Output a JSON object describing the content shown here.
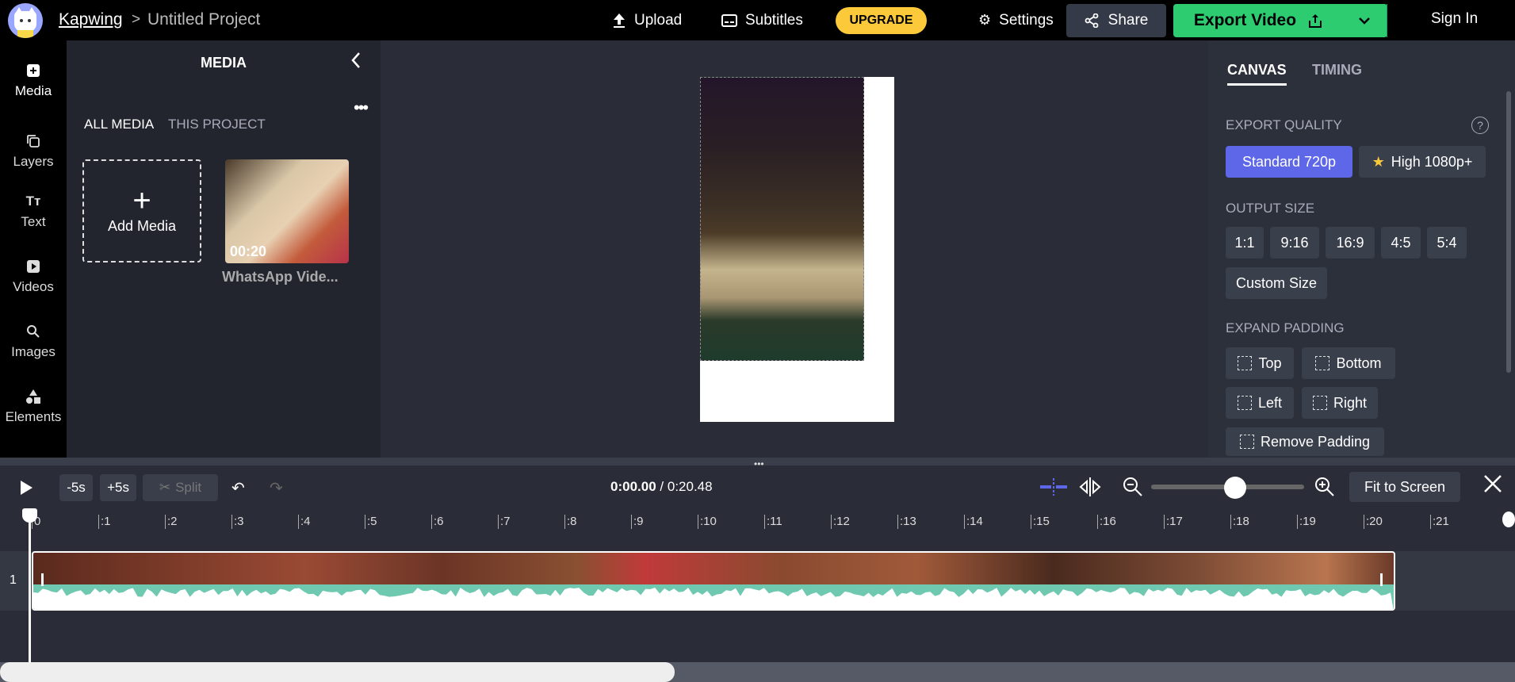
{
  "header": {
    "brand": "Kapwing",
    "separator": ">",
    "project_title": "Untitled Project",
    "upload_label": "Upload",
    "subtitles_label": "Subtitles",
    "upgrade_label": "UPGRADE",
    "settings_label": "Settings",
    "share_label": "Share",
    "export_label": "Export Video",
    "signin_label": "Sign In"
  },
  "sidebar": {
    "items": [
      {
        "label": "Media",
        "icon": "media-icon"
      },
      {
        "label": "Layers",
        "icon": "layers-icon"
      },
      {
        "label": "Text",
        "icon": "text-icon"
      },
      {
        "label": "Videos",
        "icon": "videos-icon"
      },
      {
        "label": "Images",
        "icon": "images-icon"
      },
      {
        "label": "Elements",
        "icon": "elements-icon"
      }
    ]
  },
  "media": {
    "title": "MEDIA",
    "tabs": [
      "ALL MEDIA",
      "THIS PROJECT"
    ],
    "add_label": "Add Media",
    "item": {
      "duration": "00:20",
      "name": "WhatsApp Vide..."
    }
  },
  "properties": {
    "tabs": [
      "CANVAS",
      "TIMING"
    ],
    "export_quality_label": "EXPORT QUALITY",
    "quality_options": [
      "Standard 720p",
      "High 1080p+"
    ],
    "output_size_label": "OUTPUT SIZE",
    "sizes": [
      "1:1",
      "9:16",
      "16:9",
      "4:5",
      "5:4"
    ],
    "custom_size_label": "Custom Size",
    "expand_padding_label": "EXPAND PADDING",
    "padding": [
      "Top",
      "Bottom",
      "Left",
      "Right"
    ],
    "remove_padding_label": "Remove Padding",
    "help": "?"
  },
  "controls": {
    "minus5": "-5s",
    "plus5": "+5s",
    "split": "Split",
    "current_time": "0:00.00",
    "total_time": "0:20.48",
    "fit_label": "Fit to Screen",
    "zoom_level": 0.55
  },
  "timeline": {
    "ticks": [
      "0",
      ":1",
      ":2",
      ":3",
      ":4",
      ":5",
      ":6",
      ":7",
      ":8",
      ":9",
      ":10",
      ":11",
      ":12",
      ":13",
      ":14",
      ":15",
      ":16",
      ":17",
      ":18",
      ":19",
      ":20",
      ":21"
    ],
    "track_number": "1"
  },
  "colors": {
    "accent": "#5e67e8",
    "export": "#2ecc71",
    "upgrade": "#fcc93a",
    "waveform": "#6fc8b0"
  }
}
